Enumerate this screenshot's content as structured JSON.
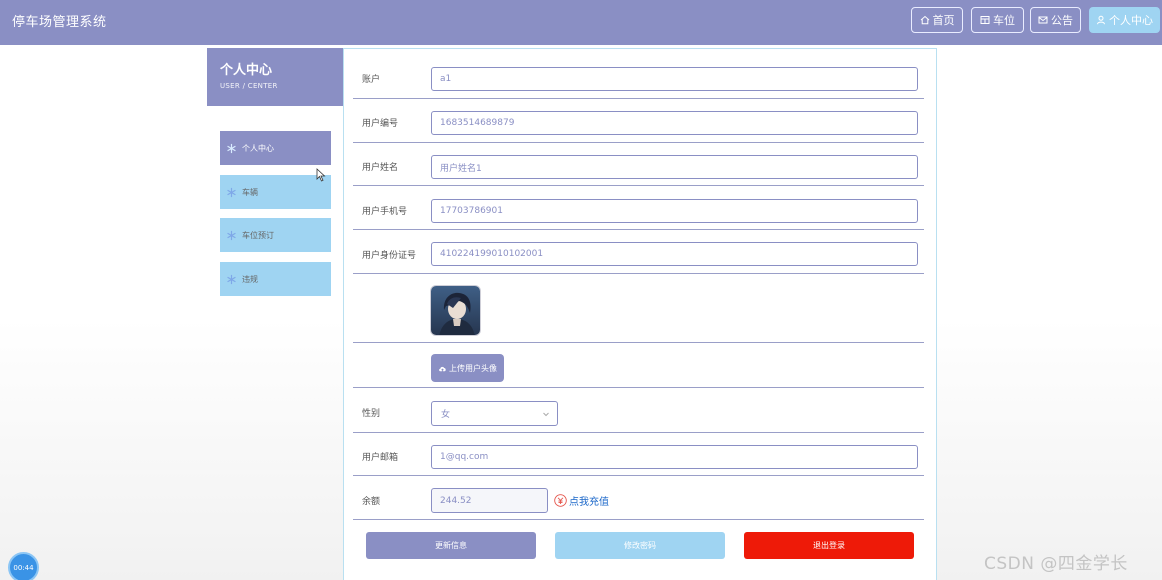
{
  "header": {
    "app_title": "停车场管理系统",
    "nav": [
      {
        "label": "首页",
        "icon": "home-icon"
      },
      {
        "label": "车位",
        "icon": "grid-icon"
      },
      {
        "label": "公告",
        "icon": "mail-icon"
      },
      {
        "label": "个人中心",
        "icon": "user-icon"
      }
    ]
  },
  "sidebar": {
    "title": "个人中心",
    "subtitle": "USER / CENTER",
    "items": [
      {
        "label": "个人中心"
      },
      {
        "label": "车辆"
      },
      {
        "label": "车位预订"
      },
      {
        "label": "违规"
      }
    ]
  },
  "form": {
    "account": {
      "label": "账户",
      "value": "a1"
    },
    "user_no": {
      "label": "用户编号",
      "value": "1683514689879"
    },
    "user_name": {
      "label": "用户姓名",
      "value": "用户姓名1"
    },
    "phone": {
      "label": "用户手机号",
      "value": "17703786901"
    },
    "id_card": {
      "label": "用户身份证号",
      "value": "410224199010102001"
    },
    "upload_avatar_label": "上传用户头像",
    "gender": {
      "label": "性别",
      "value": "女"
    },
    "email": {
      "label": "用户邮箱",
      "value": "1@qq.com"
    },
    "balance": {
      "label": "余额",
      "value": "244.52"
    },
    "recharge_label": "点我充值"
  },
  "actions": {
    "update": "更新信息",
    "change_password": "修改密码",
    "logout": "退出登录"
  },
  "overlay": {
    "timer": "00:44",
    "watermark": "CSDN @四金学长"
  },
  "colors": {
    "primary": "#8a8fc4",
    "light_blue": "#9fd4f2",
    "danger": "#ee1a08",
    "link": "#1b67c9"
  }
}
